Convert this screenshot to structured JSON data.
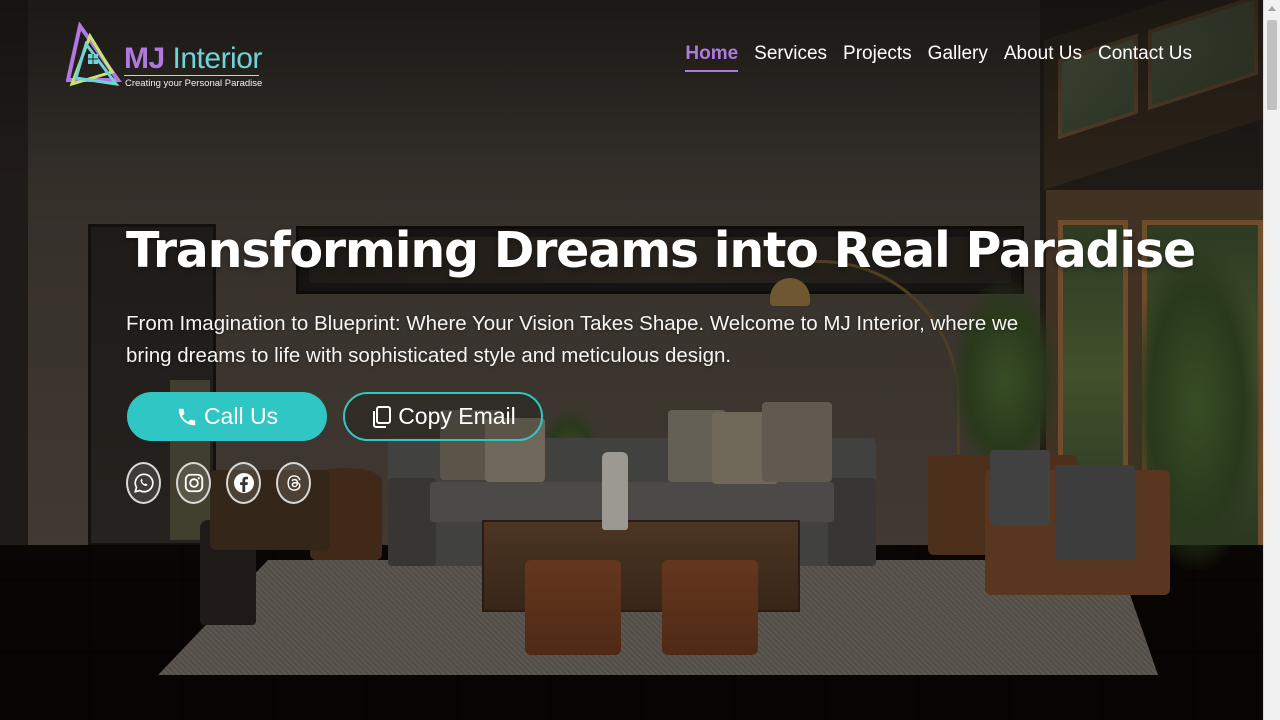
{
  "brand": {
    "name_prefix": "MJ",
    "name_suffix": "Interior",
    "tagline": "Creating your Personal Paradise",
    "colors": {
      "purple": "#b079e0",
      "teal": "#2fc6c4",
      "lime": "#c6e86a"
    }
  },
  "nav": {
    "items": [
      {
        "label": "Home",
        "active": true
      },
      {
        "label": "Services"
      },
      {
        "label": "Projects"
      },
      {
        "label": "Gallery"
      },
      {
        "label": "About Us"
      },
      {
        "label": "Contact Us"
      }
    ]
  },
  "hero": {
    "title": "Transforming Dreams into Real Paradise",
    "text": "From Imagination to Blueprint: Where Your Vision Takes Shape. Welcome to MJ Interior, where we bring dreams to life with sophisticated style and meticulous design.",
    "call_label": "Call Us",
    "call_icon": "phone-icon",
    "copy_label": "Copy Email",
    "copy_icon": "copy-icon"
  },
  "socials": [
    {
      "icon": "whatsapp-icon"
    },
    {
      "icon": "instagram-icon"
    },
    {
      "icon": "facebook-icon"
    },
    {
      "icon": "threads-icon"
    }
  ]
}
